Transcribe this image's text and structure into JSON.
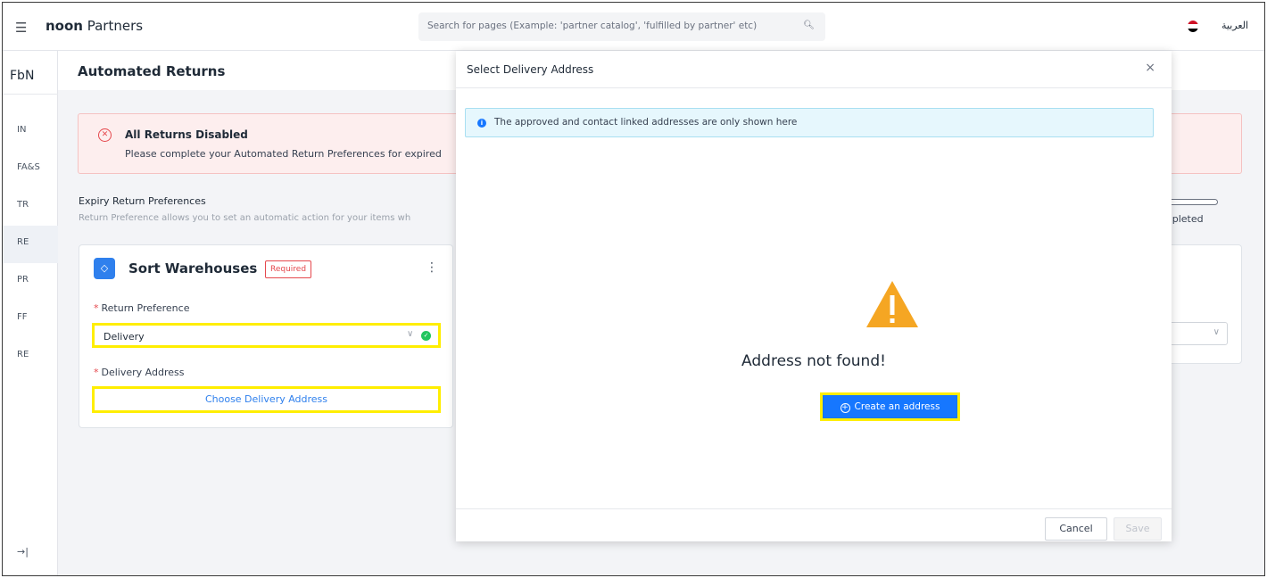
{
  "topbar": {
    "menu_icon": "hamburger-icon",
    "brand_bold": "noon",
    "brand_rest": " Partners",
    "search_placeholder": "Search for pages (Example: 'partner catalog', 'fulfilled by partner' etc)",
    "search_icon": "search-icon",
    "language": "العربية",
    "flag_colors": [
      "#ce1126",
      "#ffffff",
      "#000000"
    ]
  },
  "rail": {
    "title": "FbN",
    "items": [
      {
        "label": "IN"
      },
      {
        "label": "FA&S"
      },
      {
        "label": "TR"
      },
      {
        "label": "RE",
        "active": true
      },
      {
        "label": "PR"
      },
      {
        "label": "FF"
      },
      {
        "label": "RE"
      }
    ],
    "collapse_label": "→|"
  },
  "page": {
    "title": "Automated Returns",
    "alert": {
      "title": "All Returns Disabled",
      "text": "Please complete your Automated Return Preferences for expired"
    },
    "section": {
      "title": "Expiry Return Preferences",
      "description": "Return Preference allows you to set an automatic action for your items wh",
      "progress_label": "mpleted"
    },
    "card": {
      "title": "Sort Warehouses",
      "badge": "Required",
      "kebab": "⋮",
      "return_pref_label": "Return Preference",
      "return_pref_value": "Delivery",
      "delivery_address_label": "Delivery Address",
      "choose_address": "Choose Delivery Address",
      "required_mark": "*"
    }
  },
  "modal": {
    "title": "Select Delivery Address",
    "close": "×",
    "info": "The approved and contact linked addresses are only shown here",
    "empty_title": "Address not found!",
    "create_button": "Create an address",
    "cancel": "Cancel",
    "save": "Save"
  },
  "colors": {
    "primary": "#1677ff",
    "highlight": "#ffee00",
    "warning": "#f5a623",
    "danger": "#e5484d",
    "success": "#22c55e"
  }
}
